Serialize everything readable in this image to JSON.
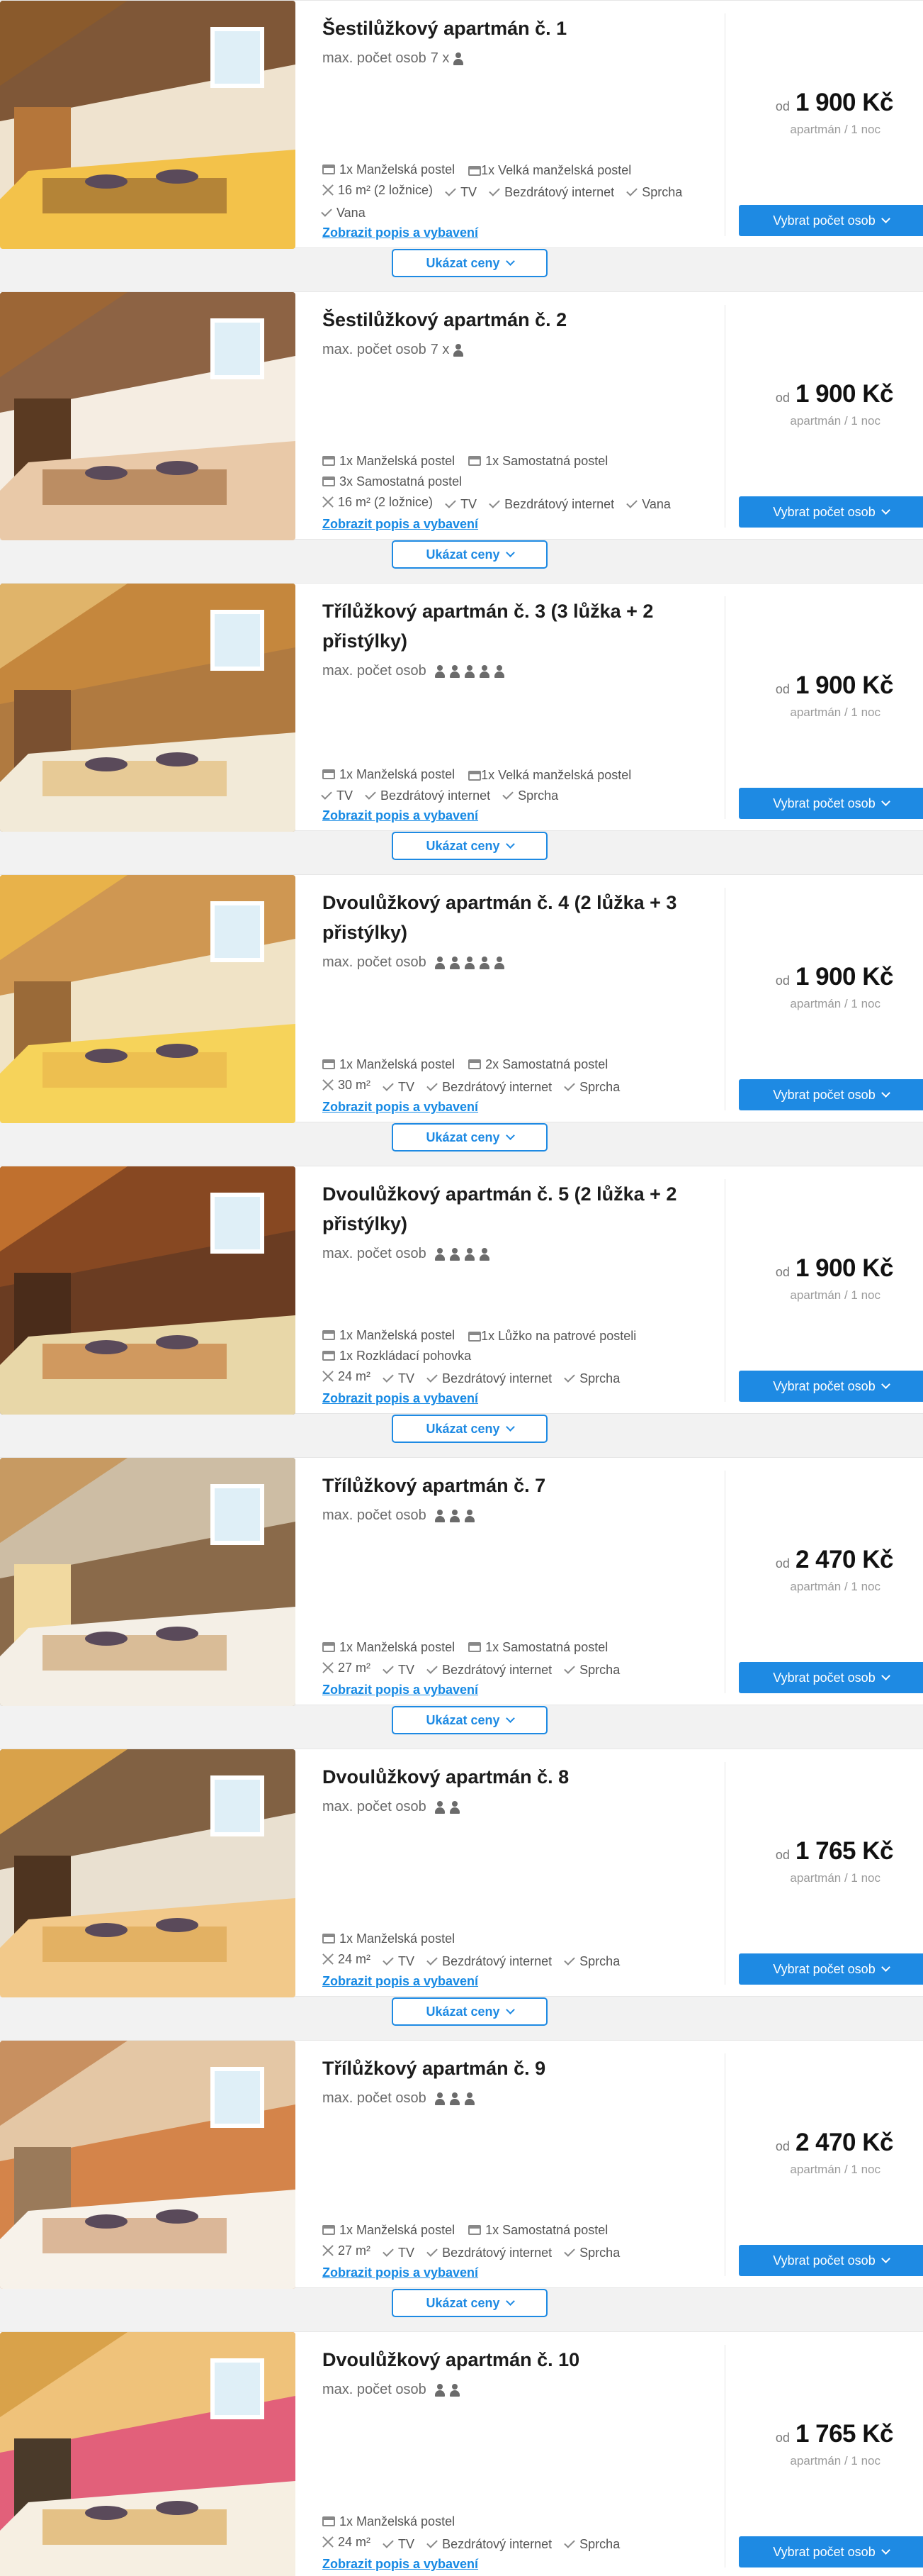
{
  "ui": {
    "max_label": "max. počet osob",
    "show_details": "Zobrazit popis a vybavení",
    "show_prices": "Ukázat ceny",
    "select_persons": "Vybrat počet osob",
    "price_from": "od",
    "price_unit": "apartmán / 1 noc"
  },
  "colors": {
    "accent": "#1e8ae3",
    "link": "#1589e4"
  },
  "rooms": [
    {
      "title": "Šestilůžkový apartmán č. 1",
      "max_text": "7 x",
      "persons": 1,
      "beds": [
        "1x Manželská postel",
        "1x Velká manželská postel"
      ],
      "area": "16 m² (2 ložnice)",
      "amenities": [
        "TV",
        "Bezdrátový internet",
        "Sprcha",
        "Vana"
      ],
      "price": "1 900 Kč",
      "photo": "attic-bedroom-beams"
    },
    {
      "title": "Šestilůžkový apartmán č. 2",
      "max_text": "7 x",
      "persons": 1,
      "beds": [
        "1x Manželská postel",
        "1x Samostatná postel",
        "3x Samostatná postel"
      ],
      "area": "16 m² (2 ložnice)",
      "amenities": [
        "TV",
        "Bezdrátový internet",
        "Vana"
      ],
      "price": "1 900 Kč",
      "photo": "attic-bedroom-wood-bed"
    },
    {
      "title": "Třílůžkový apartmán č. 3 (3 lůžka + 2 přistýlky)",
      "max_text": "",
      "persons": 5,
      "beds": [
        "1x Manželská postel",
        "1x Velká manželská postel"
      ],
      "area": "",
      "amenities": [
        "TV",
        "Bezdrátový internet",
        "Sprcha"
      ],
      "price": "1 900 Kč",
      "photo": "attic-room-dining"
    },
    {
      "title": "Dvoulůžkový apartmán č. 4 (2 lůžka + 3 přistýlky)",
      "max_text": "",
      "persons": 5,
      "beds": [
        "1x Manželská postel",
        "2x Samostatná postel"
      ],
      "area": "30 m²",
      "amenities": [
        "TV",
        "Bezdrátový internet",
        "Sprcha"
      ],
      "price": "1 900 Kč",
      "photo": "attic-room-kitchen"
    },
    {
      "title": "Dvoulůžkový apartmán č. 5 (2 lůžka + 2 přistýlky)",
      "max_text": "",
      "persons": 4,
      "beds": [
        "1x Manželská postel",
        "1x Lůžko na patrové posteli",
        "1x Rozkládací pohovka"
      ],
      "area": "24 m²",
      "amenities": [
        "TV",
        "Bezdrátový internet",
        "Sprcha"
      ],
      "price": "1 900 Kč",
      "photo": "room-loft-stairs"
    },
    {
      "title": "Třílůžkový apartmán č. 7",
      "max_text": "",
      "persons": 3,
      "beds": [
        "1x Manželská postel",
        "1x Samostatná postel"
      ],
      "area": "27 m²",
      "amenities": [
        "TV",
        "Bezdrátový internet",
        "Sprcha"
      ],
      "price": "2 470 Kč",
      "photo": "room-kitchenette"
    },
    {
      "title": "Dvoulůžkový apartmán č. 8",
      "max_text": "",
      "persons": 2,
      "beds": [
        "1x Manželská postel"
      ],
      "area": "24 m²",
      "amenities": [
        "TV",
        "Bezdrátový internet",
        "Sprcha"
      ],
      "price": "1 765 Kč",
      "photo": "double-bed-floral"
    },
    {
      "title": "Třílůžkový apartmán č. 9",
      "max_text": "",
      "persons": 3,
      "beds": [
        "1x Manželská postel",
        "1x Samostatná postel"
      ],
      "area": "27 m²",
      "amenities": [
        "TV",
        "Bezdrátový internet",
        "Sprcha"
      ],
      "price": "2 470 Kč",
      "photo": "room-kitchen-white"
    },
    {
      "title": "Dvoulůžkový apartmán č. 10",
      "max_text": "",
      "persons": 2,
      "beds": [
        "1x Manželská postel"
      ],
      "area": "24 m²",
      "amenities": [
        "TV",
        "Bezdrátový internet",
        "Sprcha"
      ],
      "price": "1 765 Kč",
      "photo": "double-bed-pink"
    }
  ]
}
